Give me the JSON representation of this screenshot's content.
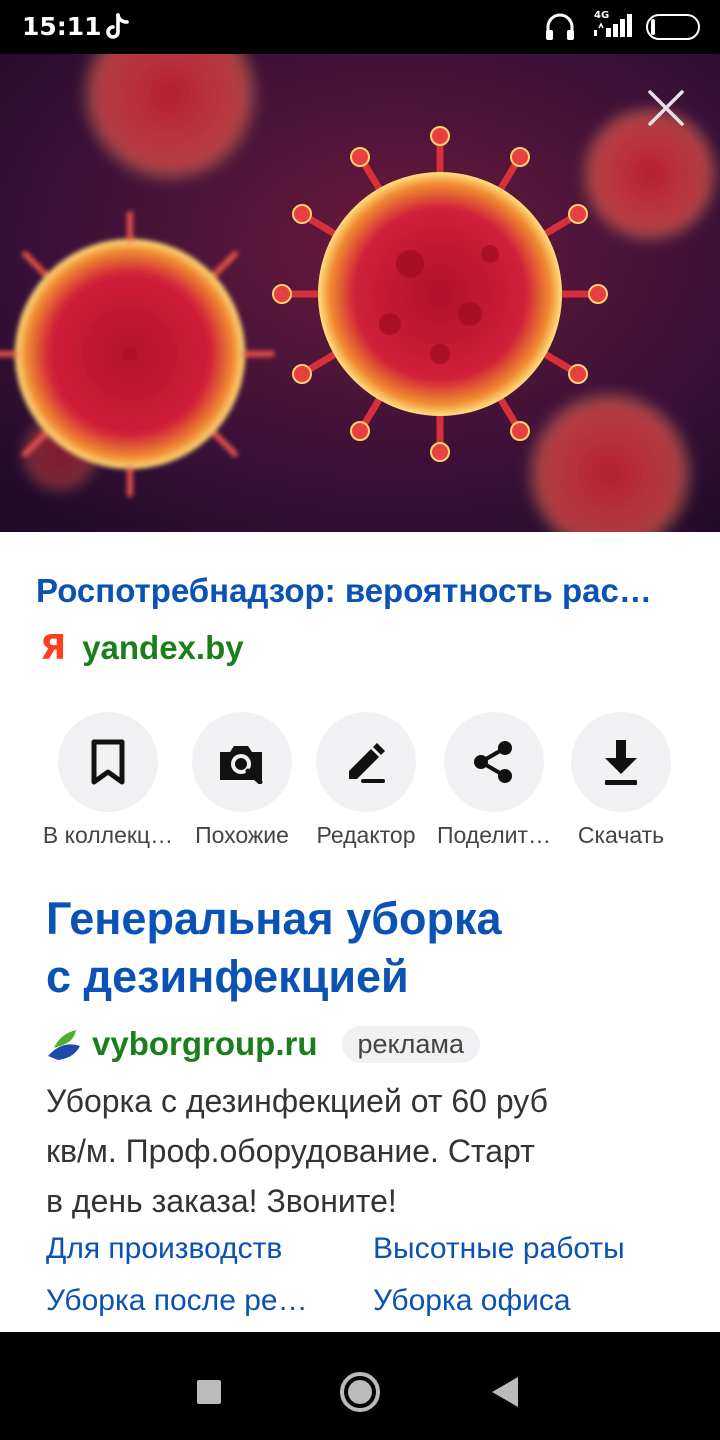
{
  "status_bar": {
    "time": "15:11",
    "network": "4G",
    "battery": "6",
    "battery_level": 0.06
  },
  "hero": {
    "image_icon": "coronavirus-image",
    "close_icon": "close-icon"
  },
  "result": {
    "title": "Роспотребнадзор: вероятность рас…",
    "logo": "Я",
    "domain": "yandex.by"
  },
  "actions": [
    {
      "label": "В коллекц…",
      "icon": "bookmark-icon"
    },
    {
      "label": "Похожие",
      "icon": "image-search-icon"
    },
    {
      "label": "Редактор",
      "icon": "pencil-icon"
    },
    {
      "label": "Поделит…",
      "icon": "share-icon"
    },
    {
      "label": "Скачать",
      "icon": "download-icon"
    }
  ],
  "ad": {
    "title_line1": "Генеральная уборка",
    "title_line2": "с дезинфекцией",
    "domain": "vyborgroup.ru",
    "badge": "реклама",
    "text_line1": "Уборка с дезинфекцией от 60 руб",
    "text_line2": "кв/м. Проф.оборудование. Старт",
    "text_line3": "в день заказа! Звоните!",
    "links": [
      "Для производств",
      "Высотные работы",
      "Уборка после ре…",
      "Уборка офиса"
    ]
  },
  "colors": {
    "link_blue": "#0b52b5",
    "domain_green": "#1a7f1a",
    "yandex_red": "#fc3f1d"
  }
}
